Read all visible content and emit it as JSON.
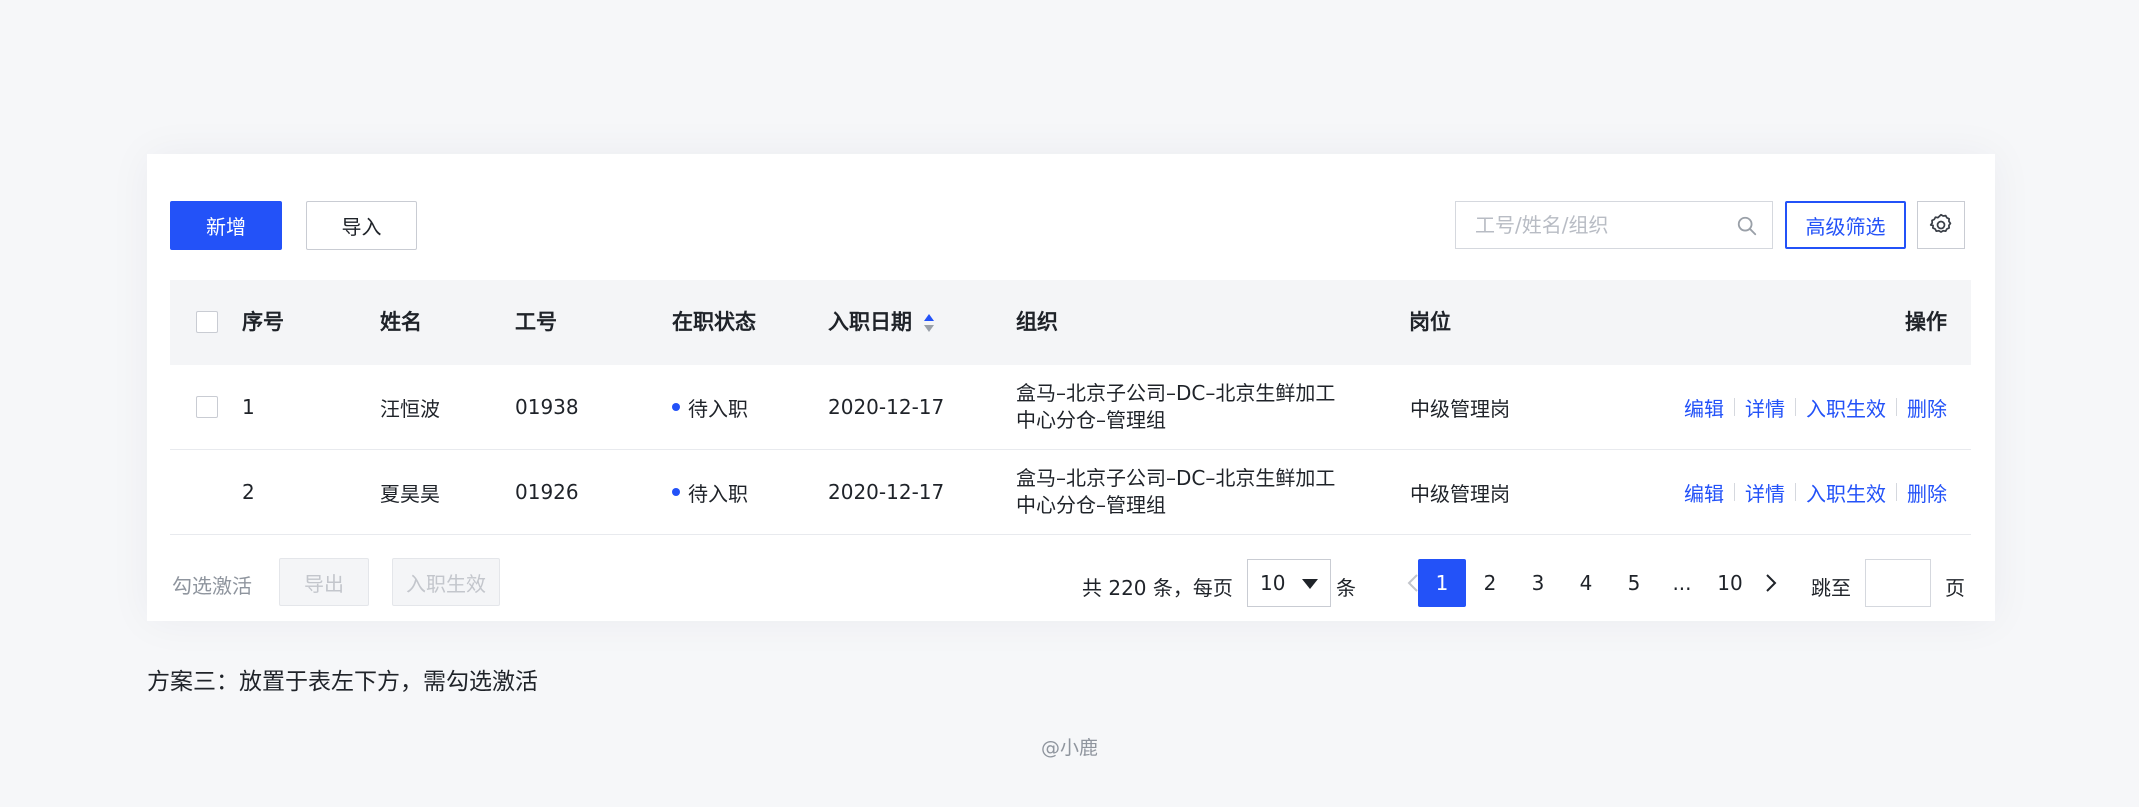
{
  "toolbar": {
    "add_label": "新增",
    "import_label": "导入",
    "search_placeholder": "工号/姓名/组织",
    "advanced_filter_label": "高级筛选"
  },
  "table": {
    "headers": {
      "index": "序号",
      "name": "姓名",
      "employee_id": "工号",
      "status": "在职状态",
      "entry_date": "入职日期",
      "organization": "组织",
      "position": "岗位",
      "actions": "操作"
    },
    "rows": [
      {
        "index": "1",
        "name": "汪恒波",
        "employee_id": "01938",
        "status": "待入职",
        "entry_date": "2020-12-17",
        "organization": "盒马–北京子公司–DC–北京生鲜加工中心分仓–管理组",
        "position": "中级管理岗"
      },
      {
        "index": "2",
        "name": "夏昊昊",
        "employee_id": "01926",
        "status": "待入职",
        "entry_date": "2020-12-17",
        "organization": "盒马–北京子公司–DC–北京生鲜加工中心分仓–管理组",
        "position": "中级管理岗"
      }
    ],
    "row_actions": {
      "edit": "编辑",
      "detail": "详情",
      "activate": "入职生效",
      "delete": "删除"
    }
  },
  "footer": {
    "hint": "勾选激活",
    "export_label": "导出",
    "activate_label": "入职生效",
    "total_text": "共 220 条，每页",
    "page_size": "10",
    "page_size_unit": "条",
    "pages": [
      "1",
      "2",
      "3",
      "4",
      "5",
      "...",
      "10"
    ],
    "current_page": "1",
    "jump_label": "跳至",
    "jump_unit": "页"
  },
  "caption": "方案三：放置于表左下方，需勾选激活",
  "credit": "@小鹿",
  "colors": {
    "primary": "#2352f8",
    "background": "#f6f7f9",
    "header_bg": "#f4f5f7"
  },
  "icons": [
    "search-icon",
    "gear-icon",
    "sort-icon",
    "chevron-left-icon",
    "chevron-right-icon",
    "caret-down-icon"
  ]
}
